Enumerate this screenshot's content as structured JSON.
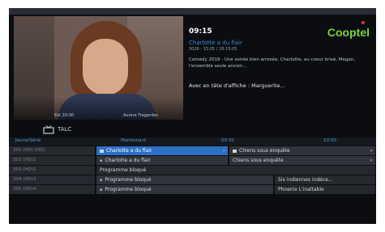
{
  "player": {
    "caption_left": "Ext 20:00",
    "caption_right": "Aurora Tragardes"
  },
  "info": {
    "time": "09:15",
    "logo": "Cooptel",
    "title": "Charlotte a du flair",
    "subtitle": "3026 - 15:05 / 18:15:05",
    "description": "Comedy 2018 - Une soirée bien arrosée, Charlotte, au coeur brisé, Megan, l'ensemble seule ancien...",
    "cast": "Avec en tête d'affiche : Marguerite..."
  },
  "channel": {
    "icon": "tv-icon",
    "name": "TALC"
  },
  "timebar": {
    "labels": [
      "Jeune/Série",
      "Maintenant",
      "09:30",
      "10:00"
    ]
  },
  "grid": {
    "rows": [
      {
        "channel": "301 (HD) (HD)",
        "programs": [
          {
            "title": "Charlotte a du flair",
            "selected": true,
            "icon": "tag-icon",
            "arrow": "«"
          },
          {
            "title": "Chiens sous enquête",
            "selected": false,
            "icon": "tag-icon",
            "arrow": "»"
          }
        ]
      },
      {
        "channel": "302 (HD)1",
        "programs": [
          {
            "title": "Charlotte a du flair",
            "selected": false,
            "icon": "dot",
            "arrow": ""
          },
          {
            "title": "Chiens sous enquête",
            "selected": false,
            "icon": "",
            "arrow": "»"
          }
        ]
      },
      {
        "channel": "303 (HD)1",
        "programs": [
          {
            "title": "Programme bloqué",
            "selected": false,
            "icon": "",
            "arrow": ""
          }
        ]
      },
      {
        "channel": "304 (HD)3",
        "programs": [
          {
            "title": "Programme bloqué",
            "selected": false,
            "icon": "dot",
            "arrow": ""
          },
          {
            "title": "Six indiennes indéce...",
            "selected": false,
            "icon": "",
            "arrow": ""
          }
        ]
      },
      {
        "channel": "305 (HD)4",
        "programs": [
          {
            "title": "Programme bloqué",
            "selected": false,
            "icon": "dot",
            "arrow": ""
          },
          {
            "title": "Phoenix L'inaltable",
            "selected": false,
            "icon": "",
            "arrow": ""
          }
        ]
      }
    ]
  },
  "colors": {
    "accent": "#2c6fc4",
    "brand": "#79d63a",
    "background": "#0b0d11"
  }
}
